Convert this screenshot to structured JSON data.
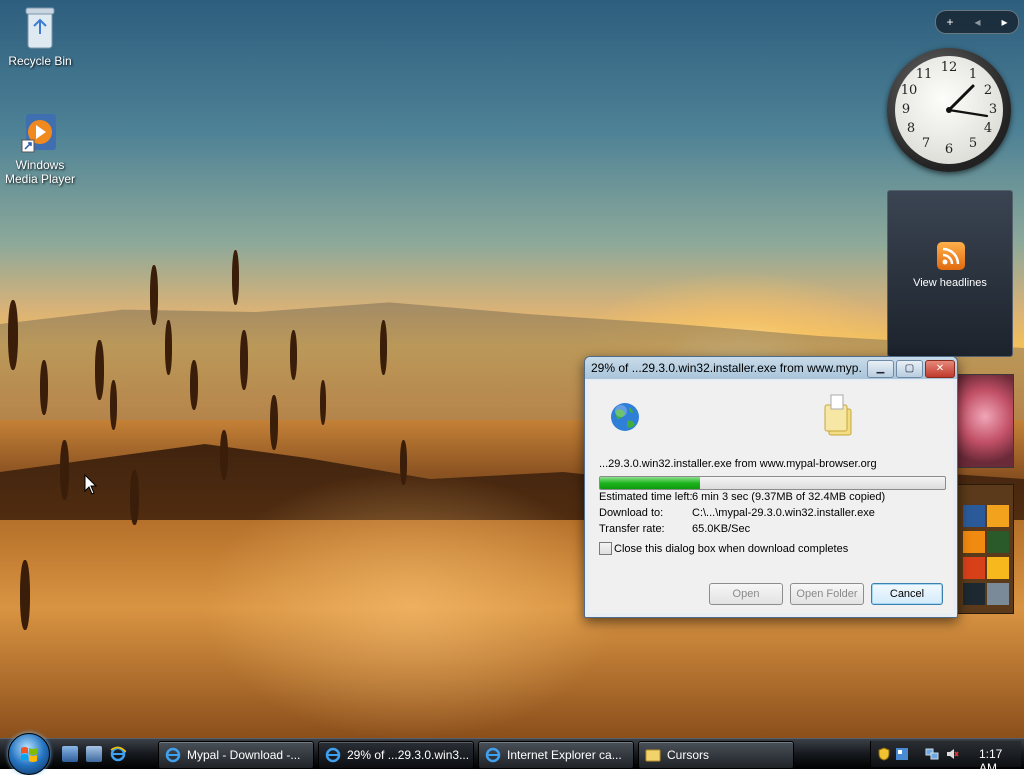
{
  "desktop": {
    "icons": [
      {
        "label": "Recycle Bin",
        "icon": "recycle-bin-icon"
      },
      {
        "label": "Windows Media Player",
        "icon": "media-player-icon"
      }
    ]
  },
  "sidebar": {
    "controls": {
      "add": "+",
      "prev": "◂",
      "next": "▸"
    },
    "clock": {
      "numbers": [
        "12",
        "1",
        "2",
        "3",
        "4",
        "5",
        "6",
        "7",
        "8",
        "9",
        "10",
        "11"
      ]
    },
    "feed": {
      "label": "View headlines",
      "icon": "rss-icon"
    }
  },
  "dialog": {
    "title": "29% of ...29.3.0.win32.installer.exe from www.myp...",
    "progress_percent": 29,
    "source": "...29.3.0.win32.installer.exe from www.mypal-browser.org",
    "labels": {
      "time_left": "Estimated time left:",
      "download_to": "Download to:",
      "transfer_rate": "Transfer rate:"
    },
    "values": {
      "time_left": "6 min 3 sec (9.37MB of 32.4MB copied)",
      "download_to": "C:\\...\\mypal-29.3.0.win32.installer.exe",
      "transfer_rate": "65.0KB/Sec"
    },
    "close_when_done": {
      "label": "Close this dialog box when download completes",
      "checked": false
    },
    "buttons": {
      "open": "Open",
      "open_folder": "Open Folder",
      "cancel": "Cancel"
    },
    "window_buttons": {
      "minimize": "▁",
      "maximize": "▢",
      "close": "✕"
    }
  },
  "taskbar": {
    "items": [
      {
        "label": "Mypal - Download -...",
        "icon": "ie-icon",
        "active": false
      },
      {
        "label": "29% of ...29.3.0.win3...",
        "icon": "ie-icon",
        "active": true
      },
      {
        "label": "Internet Explorer ca...",
        "icon": "ie-icon",
        "active": false
      },
      {
        "label": "Cursors",
        "icon": "folder-icon",
        "active": false
      }
    ],
    "clock": "1:17 AM"
  },
  "colors": {
    "accent": "#1fb51f",
    "titlebar": "#a9c4da",
    "taskbar": "#15181d"
  }
}
